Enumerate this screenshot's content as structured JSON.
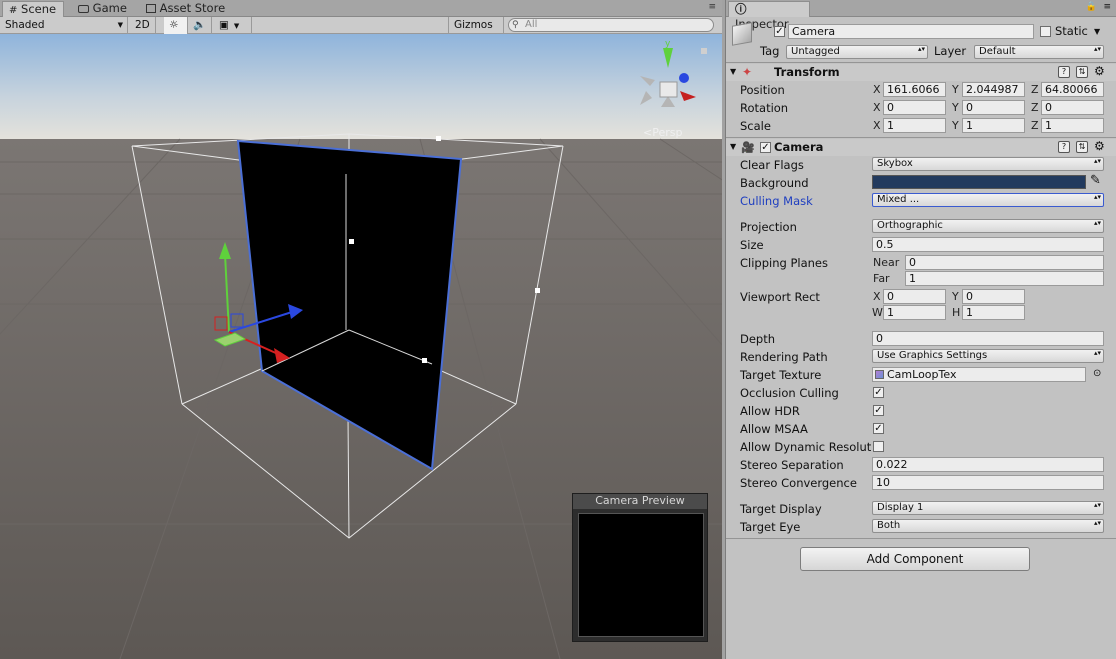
{
  "scene_tabs": {
    "scene": "Scene",
    "game": "Game",
    "asset_store": "Asset Store"
  },
  "scene_toolbar": {
    "shading": "Shaded",
    "mode_2d": "2D",
    "gizmos": "Gizmos",
    "search_placeholder": "All"
  },
  "scene_view": {
    "projection_label": "Persp",
    "gizmo_y": "y",
    "preview_title": "Camera Preview"
  },
  "inspector": {
    "tab_label": "Inspector",
    "object": {
      "name": "Camera",
      "active": true,
      "static_label": "Static",
      "tag_label": "Tag",
      "tag_value": "Untagged",
      "layer_label": "Layer",
      "layer_value": "Default"
    },
    "transform": {
      "title": "Transform",
      "position_label": "Position",
      "rotation_label": "Rotation",
      "scale_label": "Scale",
      "position": {
        "x": "161.6066",
        "y": "2.044987",
        "z": "64.80066"
      },
      "rotation": {
        "x": "0",
        "y": "0",
        "z": "0"
      },
      "scale": {
        "x": "1",
        "y": "1",
        "z": "1"
      },
      "axis_x": "X",
      "axis_y": "Y",
      "axis_z": "Z"
    },
    "camera": {
      "title": "Camera",
      "clear_flags_label": "Clear Flags",
      "clear_flags": "Skybox",
      "background_label": "Background",
      "background_color": "#223a5e",
      "culling_mask_label": "Culling Mask",
      "culling_mask": "Mixed ...",
      "projection_label": "Projection",
      "projection": "Orthographic",
      "size_label": "Size",
      "size": "0.5",
      "clipping_label": "Clipping Planes",
      "near_label": "Near",
      "near": "0",
      "far_label": "Far",
      "far": "1",
      "viewport_label": "Viewport Rect",
      "vp_x_label": "X",
      "vp_x": "0",
      "vp_y_label": "Y",
      "vp_y": "0",
      "vp_w_label": "W",
      "vp_w": "1",
      "vp_h_label": "H",
      "vp_h": "1",
      "depth_label": "Depth",
      "depth": "0",
      "rendering_path_label": "Rendering Path",
      "rendering_path": "Use Graphics Settings",
      "target_texture_label": "Target Texture",
      "target_texture": "CamLoopTex",
      "occlusion_label": "Occlusion Culling",
      "occlusion": true,
      "hdr_label": "Allow HDR",
      "hdr": true,
      "msaa_label": "Allow MSAA",
      "msaa": true,
      "dynres_label": "Allow Dynamic Resolut",
      "dynres": false,
      "stereo_sep_label": "Stereo Separation",
      "stereo_sep": "0.022",
      "stereo_conv_label": "Stereo Convergence",
      "stereo_conv": "10",
      "target_display_label": "Target Display",
      "target_display": "Display 1",
      "target_eye_label": "Target Eye",
      "target_eye": "Both"
    },
    "add_component": "Add Component"
  },
  "colors": {
    "accent_label": "#1f3fc0",
    "sky_top": "#8fb7de",
    "ground": "#5f5a56"
  }
}
